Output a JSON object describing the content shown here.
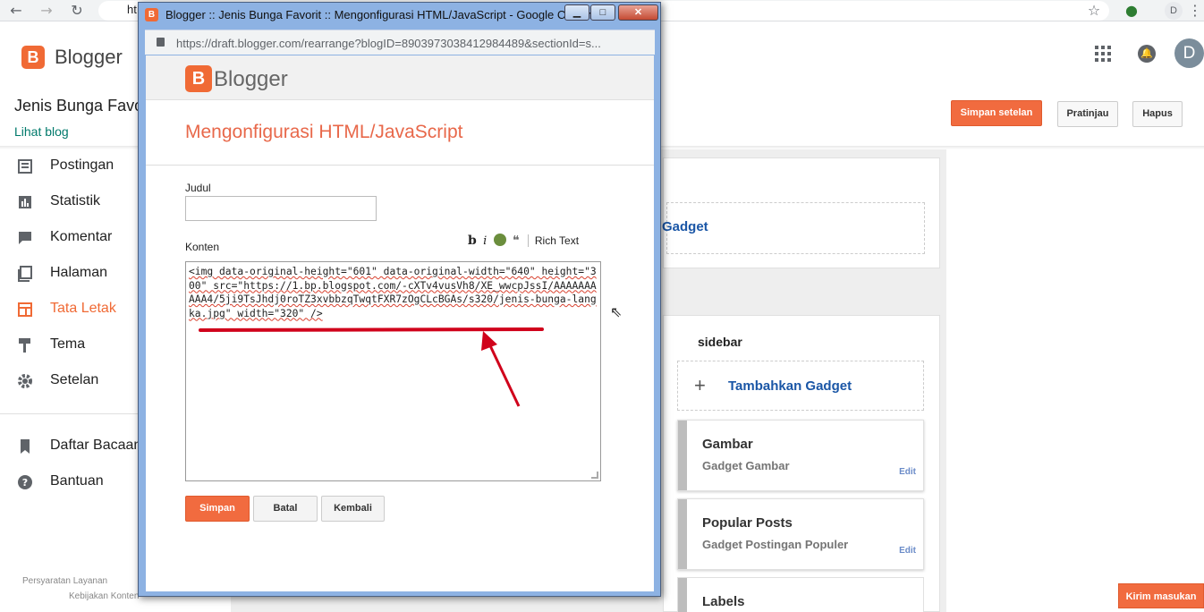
{
  "browser": {
    "back_icon": "←",
    "forward_icon": "→",
    "reload_icon": "↻",
    "address_stub": "ht",
    "star_icon": "☆",
    "profile_initial": "D",
    "menu_icon": "⋮"
  },
  "header": {
    "brand": "Blogger",
    "logo_letter": "B",
    "avatar_initial": "D"
  },
  "blog": {
    "title": "Jenis Bunga Favo",
    "view_link": "Lihat blog"
  },
  "actions": {
    "save_settings": "Simpan setelan",
    "preview": "Pratinjau",
    "delete": "Hapus"
  },
  "nav": {
    "items": [
      {
        "label": "Postingan",
        "icon": "posts-icon"
      },
      {
        "label": "Statistik",
        "icon": "stats-icon"
      },
      {
        "label": "Komentar",
        "icon": "comment-icon"
      },
      {
        "label": "Halaman",
        "icon": "pages-icon"
      },
      {
        "label": "Tata Letak",
        "icon": "layout-icon"
      },
      {
        "label": "Tema",
        "icon": "theme-icon"
      },
      {
        "label": "Setelan",
        "icon": "settings-icon"
      },
      {
        "label": "Daftar Bacaan",
        "icon": "bookmark-icon"
      },
      {
        "label": "Bantuan",
        "icon": "help-icon"
      }
    ],
    "footer": {
      "terms": "Persyaratan Layanan",
      "policy": "Kebijakan Konten"
    }
  },
  "layout_panel": {
    "top_gadget_label": "Gadget",
    "sidebar_title": "sidebar",
    "add_gadget": "Tambahkan Gadget",
    "gadgets": [
      {
        "title": "Gambar",
        "subtitle": "Gadget Gambar",
        "edit": "Edit"
      },
      {
        "title": "Popular Posts",
        "subtitle": "Gadget Postingan Populer",
        "edit": "Edit"
      },
      {
        "title": "Labels"
      }
    ],
    "feedback": "Kirim masukan"
  },
  "popup": {
    "window_title": "Blogger :: Jenis Bunga Favorit :: Mengonfigurasi HTML/JavaScript - Google Chrome",
    "url": "https://draft.blogger.com/rearrange?blogID=8903973038412984489&sectionId=s...",
    "brand": "Blogger",
    "heading": "Mengonfigurasi HTML/JavaScript",
    "title_label": "Judul",
    "title_value": "",
    "content_label": "Konten",
    "toolbar": {
      "bold": "b",
      "italic": "i",
      "quote": "❝",
      "rich_text": "Rich Text"
    },
    "content_value": "<img data-original-height=\"601\" data-original-width=\"640\" height=\"300\" src=\"https://1.bp.blogspot.com/-cXTv4vusVh8/XE_wwcpJssI/AAAAAAAAAA4/5ji9TsJhdj0roTZ3xvbbzqTwqtFXR7zOgCLcBGAs/s320/jenis-bunga-langka.jpg\" width=\"320\" />",
    "buttons": {
      "save": "Simpan",
      "cancel": "Batal",
      "back": "Kembali"
    }
  },
  "colors": {
    "accent": "#f06a35",
    "link": "#1a56a6",
    "annotation": "#d0021b"
  }
}
